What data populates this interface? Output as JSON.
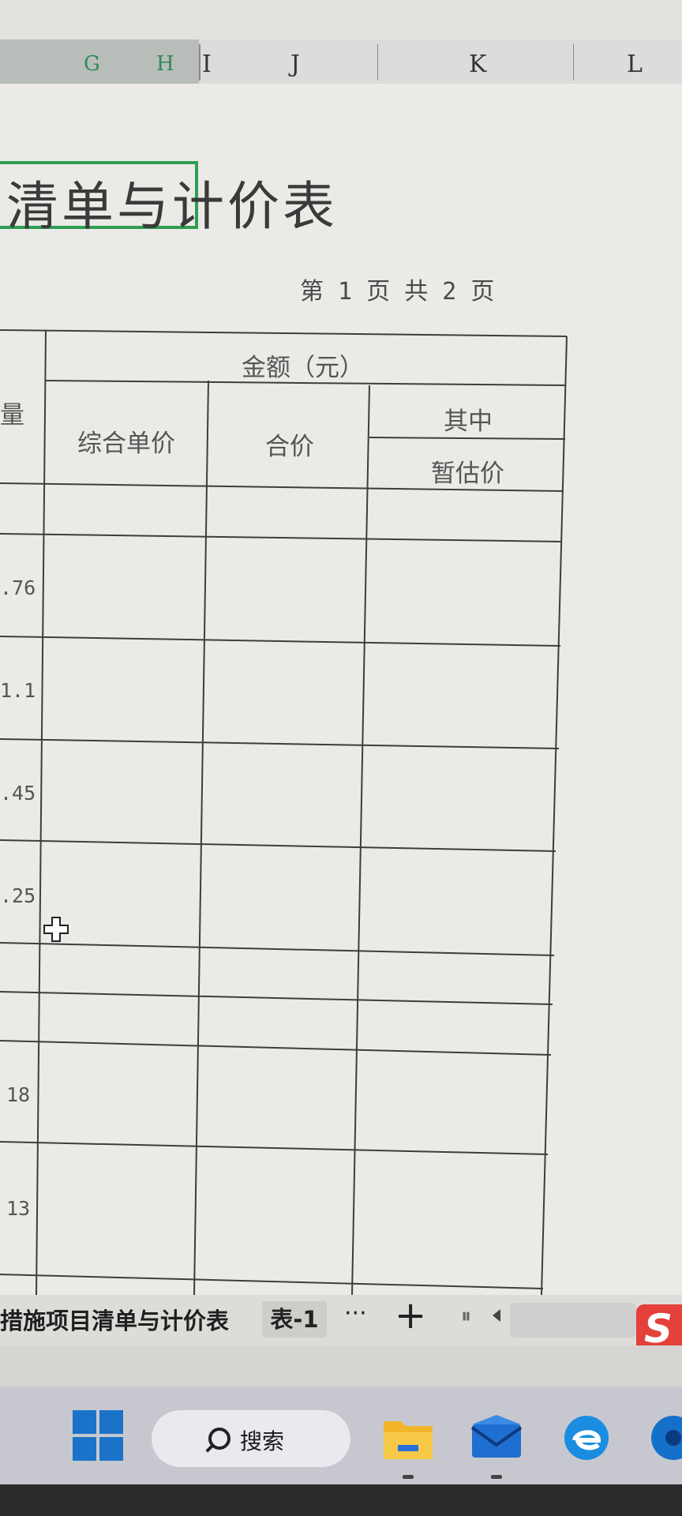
{
  "columns": [
    "G",
    "H",
    "I",
    "J",
    "K",
    "L"
  ],
  "title": "清单与计价表",
  "page_info": "第 1 页 共 2 页",
  "table": {
    "qty_header": "量",
    "amount_header": "金额（元）",
    "unit_price": "综合单价",
    "total_price": "合价",
    "of_which": "其中",
    "provisional": "暂估价",
    "quantities": [
      ".76",
      "1.1",
      ".45",
      ".25",
      "18",
      "13"
    ]
  },
  "sheet_tabs": {
    "active": "措施项目清单与计价表",
    "second": "表-1",
    "more": "···",
    "add": "+"
  },
  "taskbar": {
    "search_label": "搜索",
    "icons": [
      "windows-start-icon",
      "search-icon",
      "file-explorer-icon",
      "mail-icon",
      "edge-browser-icon"
    ]
  },
  "colors": {
    "selection": "#2f9e53",
    "sogou": "#e3413a",
    "windows": "#1a73c8"
  }
}
